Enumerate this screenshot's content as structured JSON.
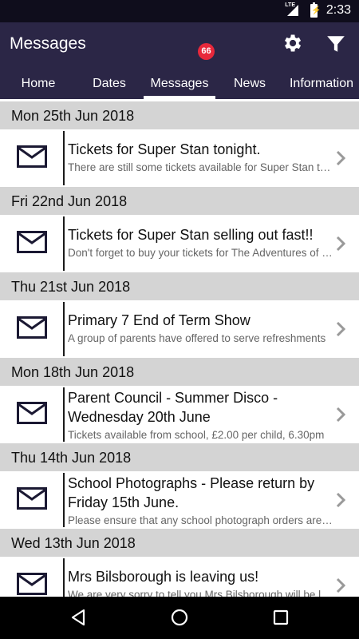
{
  "status": {
    "network": "LTE",
    "time": "2:33"
  },
  "appbar": {
    "title": "Messages",
    "settings_icon": "gear-icon",
    "filter_icon": "filter-icon"
  },
  "tabs": [
    {
      "label": "Home"
    },
    {
      "label": "Dates"
    },
    {
      "label": "Messages",
      "badge": "66",
      "selected": true
    },
    {
      "label": "News"
    },
    {
      "label": "Information"
    }
  ],
  "messages": [
    {
      "date": "Mon 25th Jun 2018",
      "title": "Tickets for Super Stan tonight.",
      "preview": "There are still some tickets available for Super Stan tonight"
    },
    {
      "date": "Fri 22nd Jun 2018",
      "title": "Tickets for Super Stan selling out fast!!",
      "preview": "Don't forget to buy your tickets for The Adventures of Super Stan"
    },
    {
      "date": "Thu 21st Jun 2018",
      "title": "Primary 7 End of Term Show",
      "preview": "A group of parents have offered to serve refreshments"
    },
    {
      "date": "Mon 18th Jun 2018",
      "title": "Parent Council - Summer Disco - Wednesday 20th June",
      "preview": "Tickets available from school, £2.00 per child, 6.30pm"
    },
    {
      "date": "Thu 14th Jun 2018",
      "title": "School Photographs - Please return by Friday 15th June.",
      "preview": "Please ensure that any school photograph orders are returned"
    },
    {
      "date": "Wed 13th Jun 2018",
      "title": "Mrs Bilsborough is leaving us!",
      "preview": "We are very sorry to tell you Mrs Bilsborough will be leaving"
    }
  ],
  "colors": {
    "appbar": "#2b2646",
    "badge": "#e8283b",
    "date_header": "#d4d4d4"
  },
  "navbar": {
    "back_icon": "back-triangle-icon",
    "home_icon": "home-circle-icon",
    "recents_icon": "recents-square-icon"
  }
}
